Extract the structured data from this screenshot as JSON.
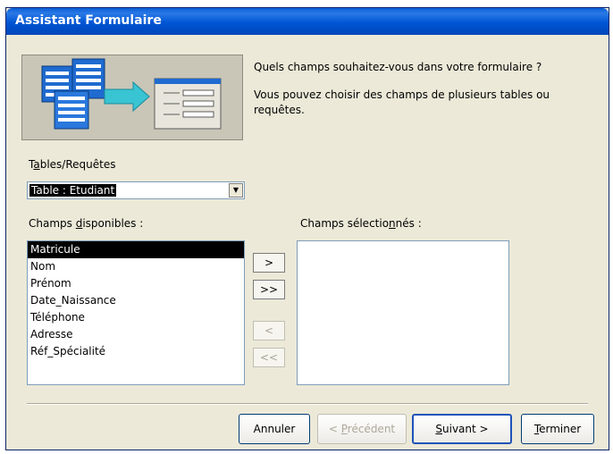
{
  "window": {
    "title": "Assistant Formulaire"
  },
  "intro": {
    "question": "Quels champs souhaitez-vous dans votre formulaire ?",
    "note": "Vous pouvez choisir des champs de plusieurs tables ou requêtes."
  },
  "tables": {
    "label_pre": "T",
    "label_key": "a",
    "label_post": "bles/Requêtes",
    "selected": "Table : Etudiant"
  },
  "available": {
    "label_pre": "Champs ",
    "label_key": "d",
    "label_post": "isponibles :",
    "items": [
      "Matricule",
      "Nom",
      "Prénom",
      "Date_Naissance",
      "Téléphone",
      "Adresse",
      "Réf_Spécialité"
    ],
    "selected_index": 0
  },
  "selected": {
    "label_pre": "Champs sélectio",
    "label_key": "n",
    "label_post": "nés :",
    "items": []
  },
  "move": {
    "add_one": ">",
    "add_all": ">>",
    "remove_one": "<",
    "remove_all": "<<"
  },
  "buttons": {
    "cancel": "Annuler",
    "previous_pre": "< ",
    "previous_key": "P",
    "previous_post": "récédent",
    "next_key": "S",
    "next_post": "uivant >",
    "finish_key": "T",
    "finish_post": "erminer"
  },
  "colors": {
    "titlebar": "#0055d4",
    "dialog_bg": "#ece9d8",
    "selection": "#000000",
    "illus_blue": "#1f6bd0",
    "illus_teal": "#39c4d4"
  }
}
